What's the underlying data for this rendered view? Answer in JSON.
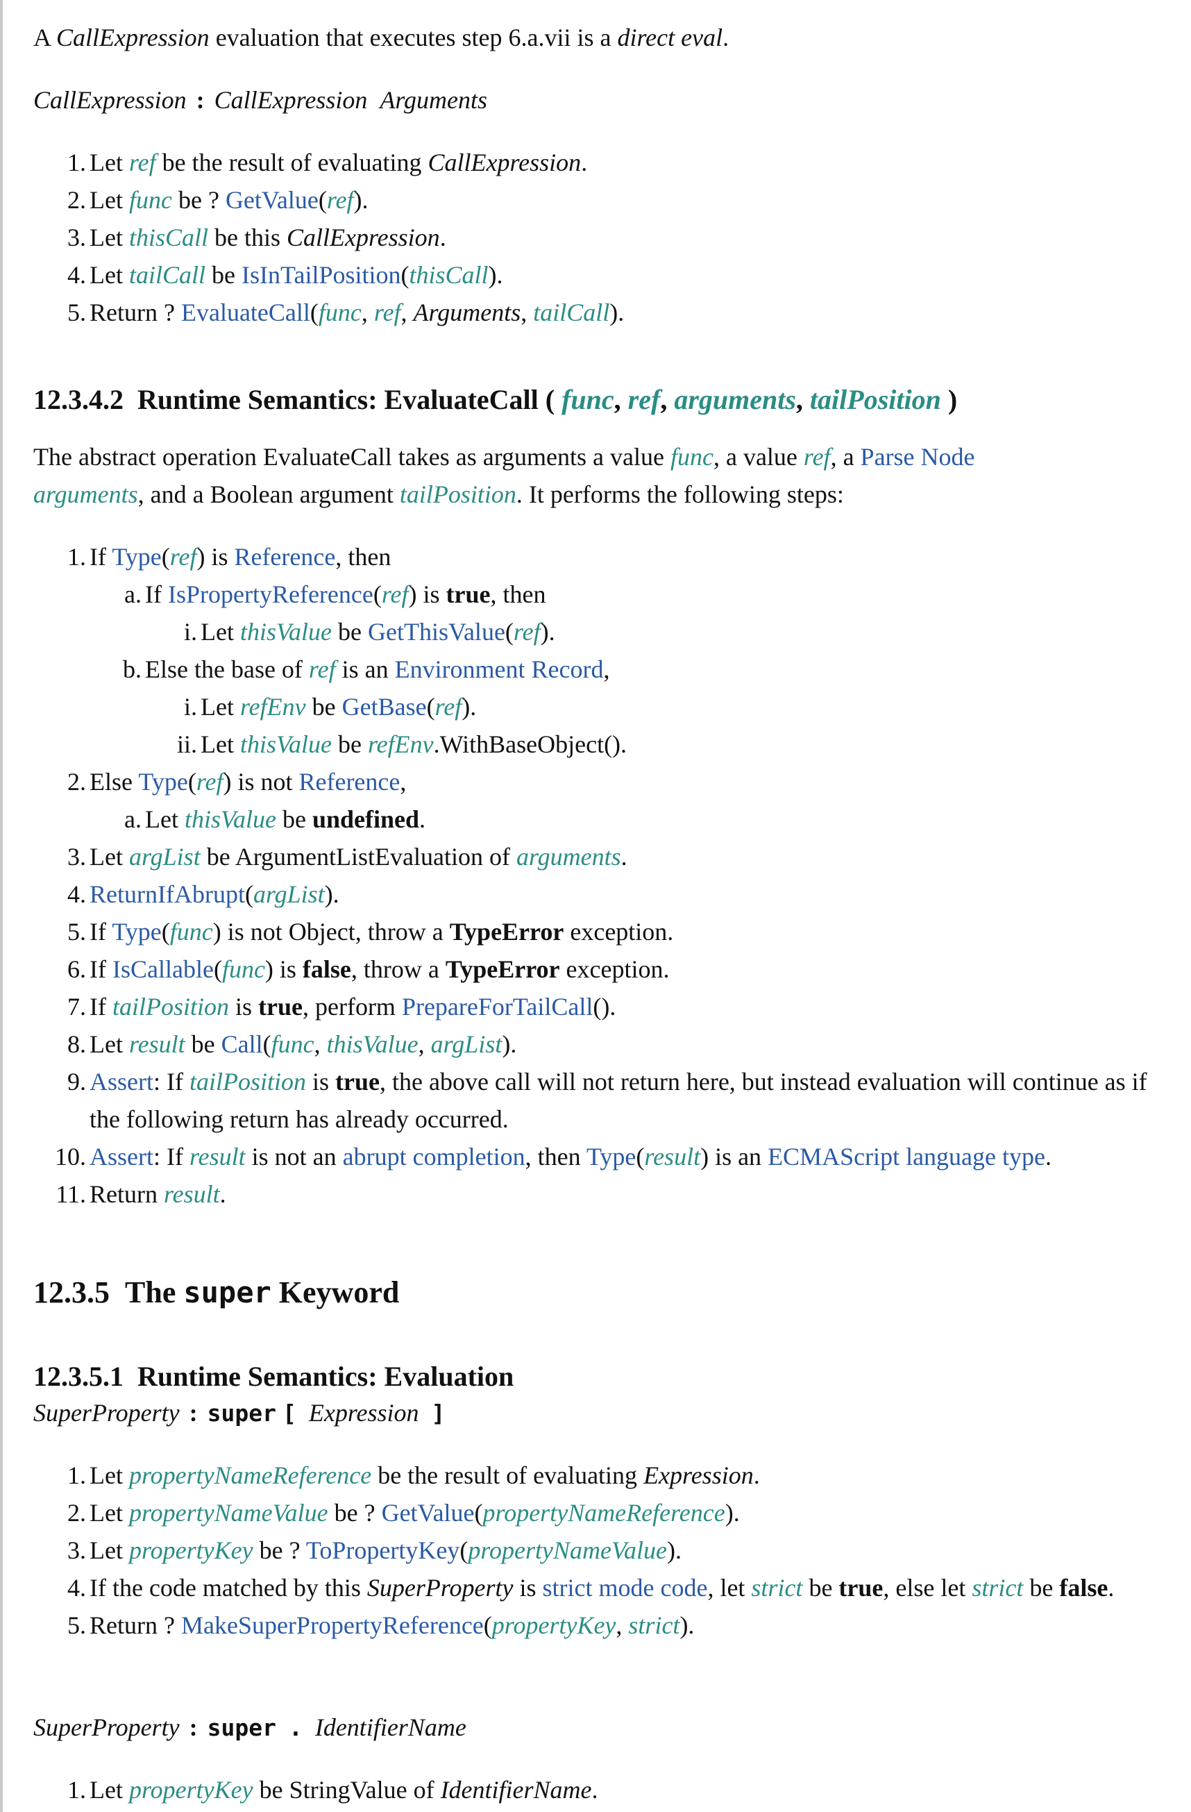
{
  "intro": {
    "s1": "A ",
    "nt1": "CallExpression",
    "s2": " evaluation that executes step 6.a.vii is a ",
    "term": "direct eval",
    "s3": "."
  },
  "prod1": {
    "lhs": "CallExpression",
    "colon": ":",
    "rhs1": "CallExpression",
    "rhs2": "Arguments"
  },
  "alg1": [
    {
      "n": "1.",
      "a": "Let ",
      "v1": "ref",
      "b": " be the result of evaluating ",
      "nt": "CallExpression",
      "c": "."
    },
    {
      "n": "2.",
      "a": "Let ",
      "v1": "func",
      "b": " be ? ",
      "l1": "GetValue",
      "c": "(",
      "v2": "ref",
      "d": ")."
    },
    {
      "n": "3.",
      "a": "Let ",
      "v1": "thisCall",
      "b": " be this ",
      "nt": "CallExpression",
      "c": "."
    },
    {
      "n": "4.",
      "a": "Let ",
      "v1": "tailCall",
      "b": " be ",
      "l1": "IsInTailPosition",
      "c": "(",
      "v2": "thisCall",
      "d": ")."
    },
    {
      "n": "5.",
      "a": "Return ? ",
      "l1": "EvaluateCall",
      "b": "(",
      "v1": "func",
      "c": ", ",
      "v2": "ref",
      "d": ", ",
      "nt": "Arguments",
      "e": ", ",
      "v3": "tailCall",
      "f": ")."
    }
  ],
  "sec1": {
    "num": "12.3.4.2",
    "title": "Runtime Semantics: EvaluateCall",
    "open": " ( ",
    "p1": "func",
    "p2": "ref",
    "p3": "arguments",
    "p4": "tailPosition",
    "sep": ", ",
    "close": " )"
  },
  "para1": {
    "a": "The abstract operation EvaluateCall takes as arguments a value ",
    "v1": "func",
    "b": ", a value ",
    "v2": "ref",
    "c": ", a ",
    "l1": "Parse Node",
    "v3": "arguments",
    "d": ", and a Boolean argument ",
    "v4": "tailPosition",
    "e": ". It performs the following steps:"
  },
  "alg2": {
    "s1": {
      "n": "1.",
      "a": "If ",
      "l1": "Type",
      "b": "(",
      "v1": "ref",
      "c": ") is ",
      "l2": "Reference",
      "d": ", then"
    },
    "s1a": {
      "n": "a.",
      "a": "If ",
      "l1": "IsPropertyReference",
      "b": "(",
      "v1": "ref",
      "c": ") is ",
      "k": "true",
      "d": ", then"
    },
    "s1ai": {
      "n": "i.",
      "a": "Let ",
      "v1": "thisValue",
      "b": " be ",
      "l1": "GetThisValue",
      "c": "(",
      "v2": "ref",
      "d": ")."
    },
    "s1b": {
      "n": "b.",
      "a": "Else the base of ",
      "v1": "ref",
      "b": " is an ",
      "l1": "Environment Record",
      "c": ","
    },
    "s1bi": {
      "n": "i.",
      "a": "Let ",
      "v1": "refEnv",
      "b": " be ",
      "l1": "GetBase",
      "c": "(",
      "v2": "ref",
      "d": ")."
    },
    "s1bii": {
      "n": "ii.",
      "a": "Let ",
      "v1": "thisValue",
      "b": " be ",
      "v2": "refEnv",
      "c": ".WithBaseObject()."
    },
    "s2": {
      "n": "2.",
      "a": "Else ",
      "l1": "Type",
      "b": "(",
      "v1": "ref",
      "c": ") is not ",
      "l2": "Reference",
      "d": ","
    },
    "s2a": {
      "n": "a.",
      "a": "Let ",
      "v1": "thisValue",
      "b": " be ",
      "k": "undefined",
      "c": "."
    },
    "s3": {
      "n": "3.",
      "a": "Let ",
      "v1": "argList",
      "b": " be ArgumentListEvaluation of ",
      "v2": "arguments",
      "c": "."
    },
    "s4": {
      "n": "4.",
      "l1": "ReturnIfAbrupt",
      "a": "(",
      "v1": "argList",
      "b": ")."
    },
    "s5": {
      "n": "5.",
      "a": "If ",
      "l1": "Type",
      "b": "(",
      "v1": "func",
      "c": ") is not Object, throw a ",
      "k": "TypeError",
      "d": " exception."
    },
    "s6": {
      "n": "6.",
      "a": "If ",
      "l1": "IsCallable",
      "b": "(",
      "v1": "func",
      "c": ") is ",
      "k1": "false",
      "d": ", throw a ",
      "k2": "TypeError",
      "e": " exception."
    },
    "s7": {
      "n": "7.",
      "a": "If ",
      "v1": "tailPosition",
      "b": " is ",
      "k": "true",
      "c": ", perform ",
      "l1": "PrepareForTailCall",
      "d": "()."
    },
    "s8": {
      "n": "8.",
      "a": "Let ",
      "v1": "result",
      "b": " be ",
      "l1": "Call",
      "c": "(",
      "v2": "func",
      "d": ", ",
      "v3": "thisValue",
      "e": ", ",
      "v4": "argList",
      "f": ")."
    },
    "s9": {
      "n": "9.",
      "l1": "Assert",
      "a": ": If ",
      "v1": "tailPosition",
      "b": " is ",
      "k": "true",
      "c": ", the above call will not return here, but instead evaluation will continue as if the following return has already occurred."
    },
    "s10": {
      "n": "10.",
      "l1": "Assert",
      "a": ": If ",
      "v1": "result",
      "b": " is not an ",
      "l2": "abrupt completion",
      "c": ", then ",
      "l3": "Type",
      "d": "(",
      "v2": "result",
      "e": ") is an ",
      "l4": "ECMAScript language type",
      "f": "."
    },
    "s11": {
      "n": "11.",
      "a": "Return ",
      "v1": "result",
      "b": "."
    }
  },
  "sec2": {
    "num": "12.3.5",
    "pre": "The ",
    "kw": "super",
    "post": " Keyword"
  },
  "sec3": {
    "num": "12.3.5.1",
    "title": "Runtime Semantics: Evaluation"
  },
  "prod2": {
    "lhs": "SuperProperty",
    "colon": ":",
    "kw": "super",
    "lb": "[",
    "nt": "Expression",
    "rb": "]"
  },
  "alg3": [
    {
      "n": "1.",
      "a": "Let ",
      "v1": "propertyNameReference",
      "b": " be the result of evaluating ",
      "nt": "Expression",
      "c": "."
    },
    {
      "n": "2.",
      "a": "Let ",
      "v1": "propertyNameValue",
      "b": " be ? ",
      "l1": "GetValue",
      "c": "(",
      "v2": "propertyNameReference",
      "d": ")."
    },
    {
      "n": "3.",
      "a": "Let ",
      "v1": "propertyKey",
      "b": " be ? ",
      "l1": "ToPropertyKey",
      "c": "(",
      "v2": "propertyNameValue",
      "d": ")."
    },
    {
      "n": "4.",
      "a": "If the code matched by this ",
      "nt": "SuperProperty",
      "b": " is ",
      "l1": "strict mode code",
      "c": ", let ",
      "v1": "strict",
      "d": " be ",
      "k1": "true",
      "e": ", else let ",
      "v2": "strict",
      "f": " be ",
      "k2": "false",
      "g": "."
    },
    {
      "n": "5.",
      "a": "Return ? ",
      "l1": "MakeSuperPropertyReference",
      "b": "(",
      "v1": "propertyKey",
      "c": ", ",
      "v2": "strict",
      "d": ")."
    }
  ],
  "prod3": {
    "lhs": "SuperProperty",
    "colon": ":",
    "kw": "super",
    "dot": ".",
    "nt": "IdentifierName"
  },
  "alg4": [
    {
      "n": "1.",
      "a": "Let ",
      "v1": "propertyKey",
      "b": " be StringValue of ",
      "nt": "IdentifierName",
      "c": "."
    }
  ]
}
